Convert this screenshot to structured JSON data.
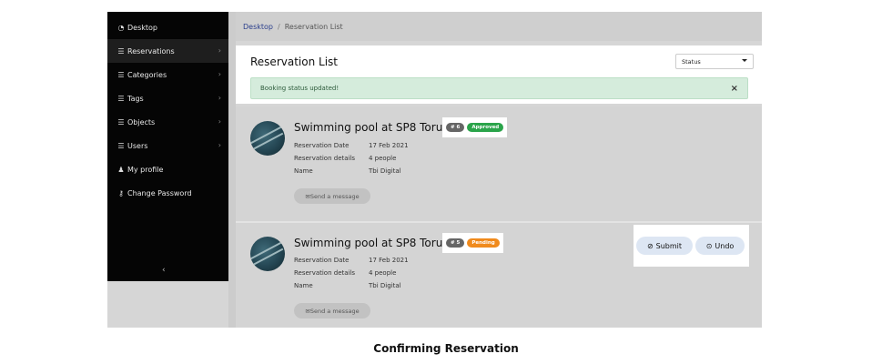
{
  "sidebar": {
    "items": [
      {
        "label": "Desktop",
        "icon": "dashboard-icon",
        "glyph": "◔",
        "has_chevron": false
      },
      {
        "label": "Reservations",
        "icon": "list-icon",
        "glyph": "☰",
        "has_chevron": true,
        "active": true
      },
      {
        "label": "Categories",
        "icon": "list-icon",
        "glyph": "☰",
        "has_chevron": true
      },
      {
        "label": "Tags",
        "icon": "list-icon",
        "glyph": "☰",
        "has_chevron": true
      },
      {
        "label": "Objects",
        "icon": "list-icon",
        "glyph": "☰",
        "has_chevron": true
      },
      {
        "label": "Users",
        "icon": "list-icon",
        "glyph": "☰",
        "has_chevron": true
      },
      {
        "label": "My profile",
        "icon": "user-icon",
        "glyph": "♟",
        "has_chevron": false
      },
      {
        "label": "Change Password",
        "icon": "key-icon",
        "glyph": "⚷",
        "has_chevron": false
      }
    ],
    "collapse_glyph": "‹"
  },
  "breadcrumb": {
    "home": "Desktop",
    "separator": "/",
    "current": "Reservation List"
  },
  "list_panel": {
    "title": "Reservation List",
    "status_select": "Status",
    "alert": "Booking status updated!",
    "alert_close": "×"
  },
  "reservations": [
    {
      "title": "Swimming pool at SP8 Toruń",
      "number": "# 6",
      "status": "Approved",
      "rows": [
        {
          "label": "Reservation Date",
          "value": "17 Feb 2021"
        },
        {
          "label": "Reservation details",
          "value": "4 people"
        },
        {
          "label": "Name",
          "value": "Tbi Digital"
        }
      ],
      "message_button": "✉Send a message"
    },
    {
      "title": "Swimming pool at SP8 Toruń",
      "number": "# 5",
      "status": "Pending",
      "rows": [
        {
          "label": "Reservation Date",
          "value": "17 Feb 2021"
        },
        {
          "label": "Reservation details",
          "value": "4 people"
        },
        {
          "label": "Name",
          "value": "Tbi Digital"
        }
      ],
      "message_button": "✉Send a message"
    }
  ],
  "actions": {
    "submit": "Submit",
    "undo": "Undo"
  },
  "caption": "Confirming Reservation"
}
